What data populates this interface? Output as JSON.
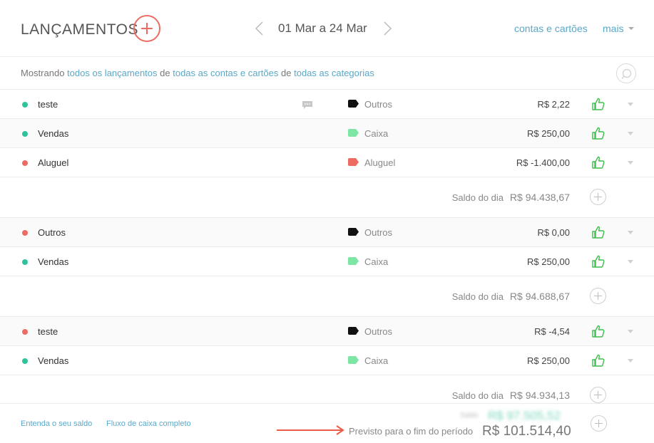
{
  "header": {
    "title": "LANÇAMENTOS",
    "date_range": "01 Mar a 24 Mar",
    "accounts_link": "contas e cartões",
    "more_link": "mais"
  },
  "filter": {
    "prefix": "Mostrando",
    "entries_link": "todos os lançamentos",
    "of1": "de",
    "accounts_link": "todas as contas e cartões",
    "of2": "de",
    "categories_link": "todas as categorias"
  },
  "colors": {
    "accent_red": "#ec6b62",
    "link_blue": "#5aa8c8",
    "income_green": "#2ec39a",
    "tag_green": "#7ee6a4",
    "tag_red": "#ec6b62",
    "tag_black": "#111111"
  },
  "groups": [
    {
      "rows": [
        {
          "status": "green",
          "description": "teste",
          "has_comment": true,
          "tag_color": "black",
          "category": "Outros",
          "amount": "R$ 2,22"
        },
        {
          "status": "green",
          "description": "Vendas",
          "has_comment": false,
          "tag_color": "green",
          "category": "Caixa",
          "amount": "R$ 250,00"
        },
        {
          "status": "red",
          "description": "Aluguel",
          "has_comment": false,
          "tag_color": "red",
          "category": "Aluguel",
          "amount": "R$ -1.400,00"
        }
      ],
      "saldo_label": "Saldo do dia",
      "saldo_value": "R$ 94.438,67"
    },
    {
      "rows": [
        {
          "status": "red",
          "description": "Outros",
          "has_comment": false,
          "tag_color": "black",
          "category": "Outros",
          "amount": "R$ 0,00"
        },
        {
          "status": "green",
          "description": "Vendas",
          "has_comment": false,
          "tag_color": "green",
          "category": "Caixa",
          "amount": "R$ 250,00"
        }
      ],
      "saldo_label": "Saldo do dia",
      "saldo_value": "R$ 94.688,67"
    },
    {
      "rows": [
        {
          "status": "red",
          "description": "teste",
          "has_comment": false,
          "tag_color": "black",
          "category": "Outros",
          "amount": "R$ -4,54"
        },
        {
          "status": "green",
          "description": "Vendas",
          "has_comment": false,
          "tag_color": "green",
          "category": "Caixa",
          "amount": "R$ 250,00"
        }
      ],
      "saldo_label": "Saldo do dia",
      "saldo_value": "R$ 94.934,13"
    }
  ],
  "footer": {
    "link_balance": "Entenda o seu saldo",
    "link_cashflow": "Fluxo de caixa completo",
    "blurred_label": "Saldo",
    "blurred_value": "R$ 97.505,52",
    "forecast_label": "Previsto para o fim do período",
    "forecast_value": "R$ 101.514,40"
  }
}
